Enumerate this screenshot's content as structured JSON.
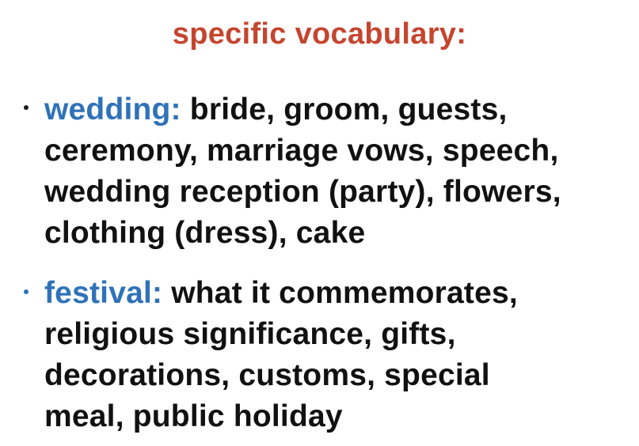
{
  "slide": {
    "title": "specific vocabulary:",
    "title_color": "#c5452f",
    "label_color": "#2f72b8",
    "bullets": [
      {
        "label": "wedding:",
        "lines": [
          "bride, groom, guests,",
          "ceremony, marriage vows, speech,",
          "wedding reception (party), flowers,",
          "clothing (dress), cake"
        ]
      },
      {
        "label": "festival:",
        "lines": [
          "what it commemorates,",
          "religious significance, gifts,",
          "decorations, customs, special",
          "meal, public holiday"
        ]
      }
    ]
  }
}
